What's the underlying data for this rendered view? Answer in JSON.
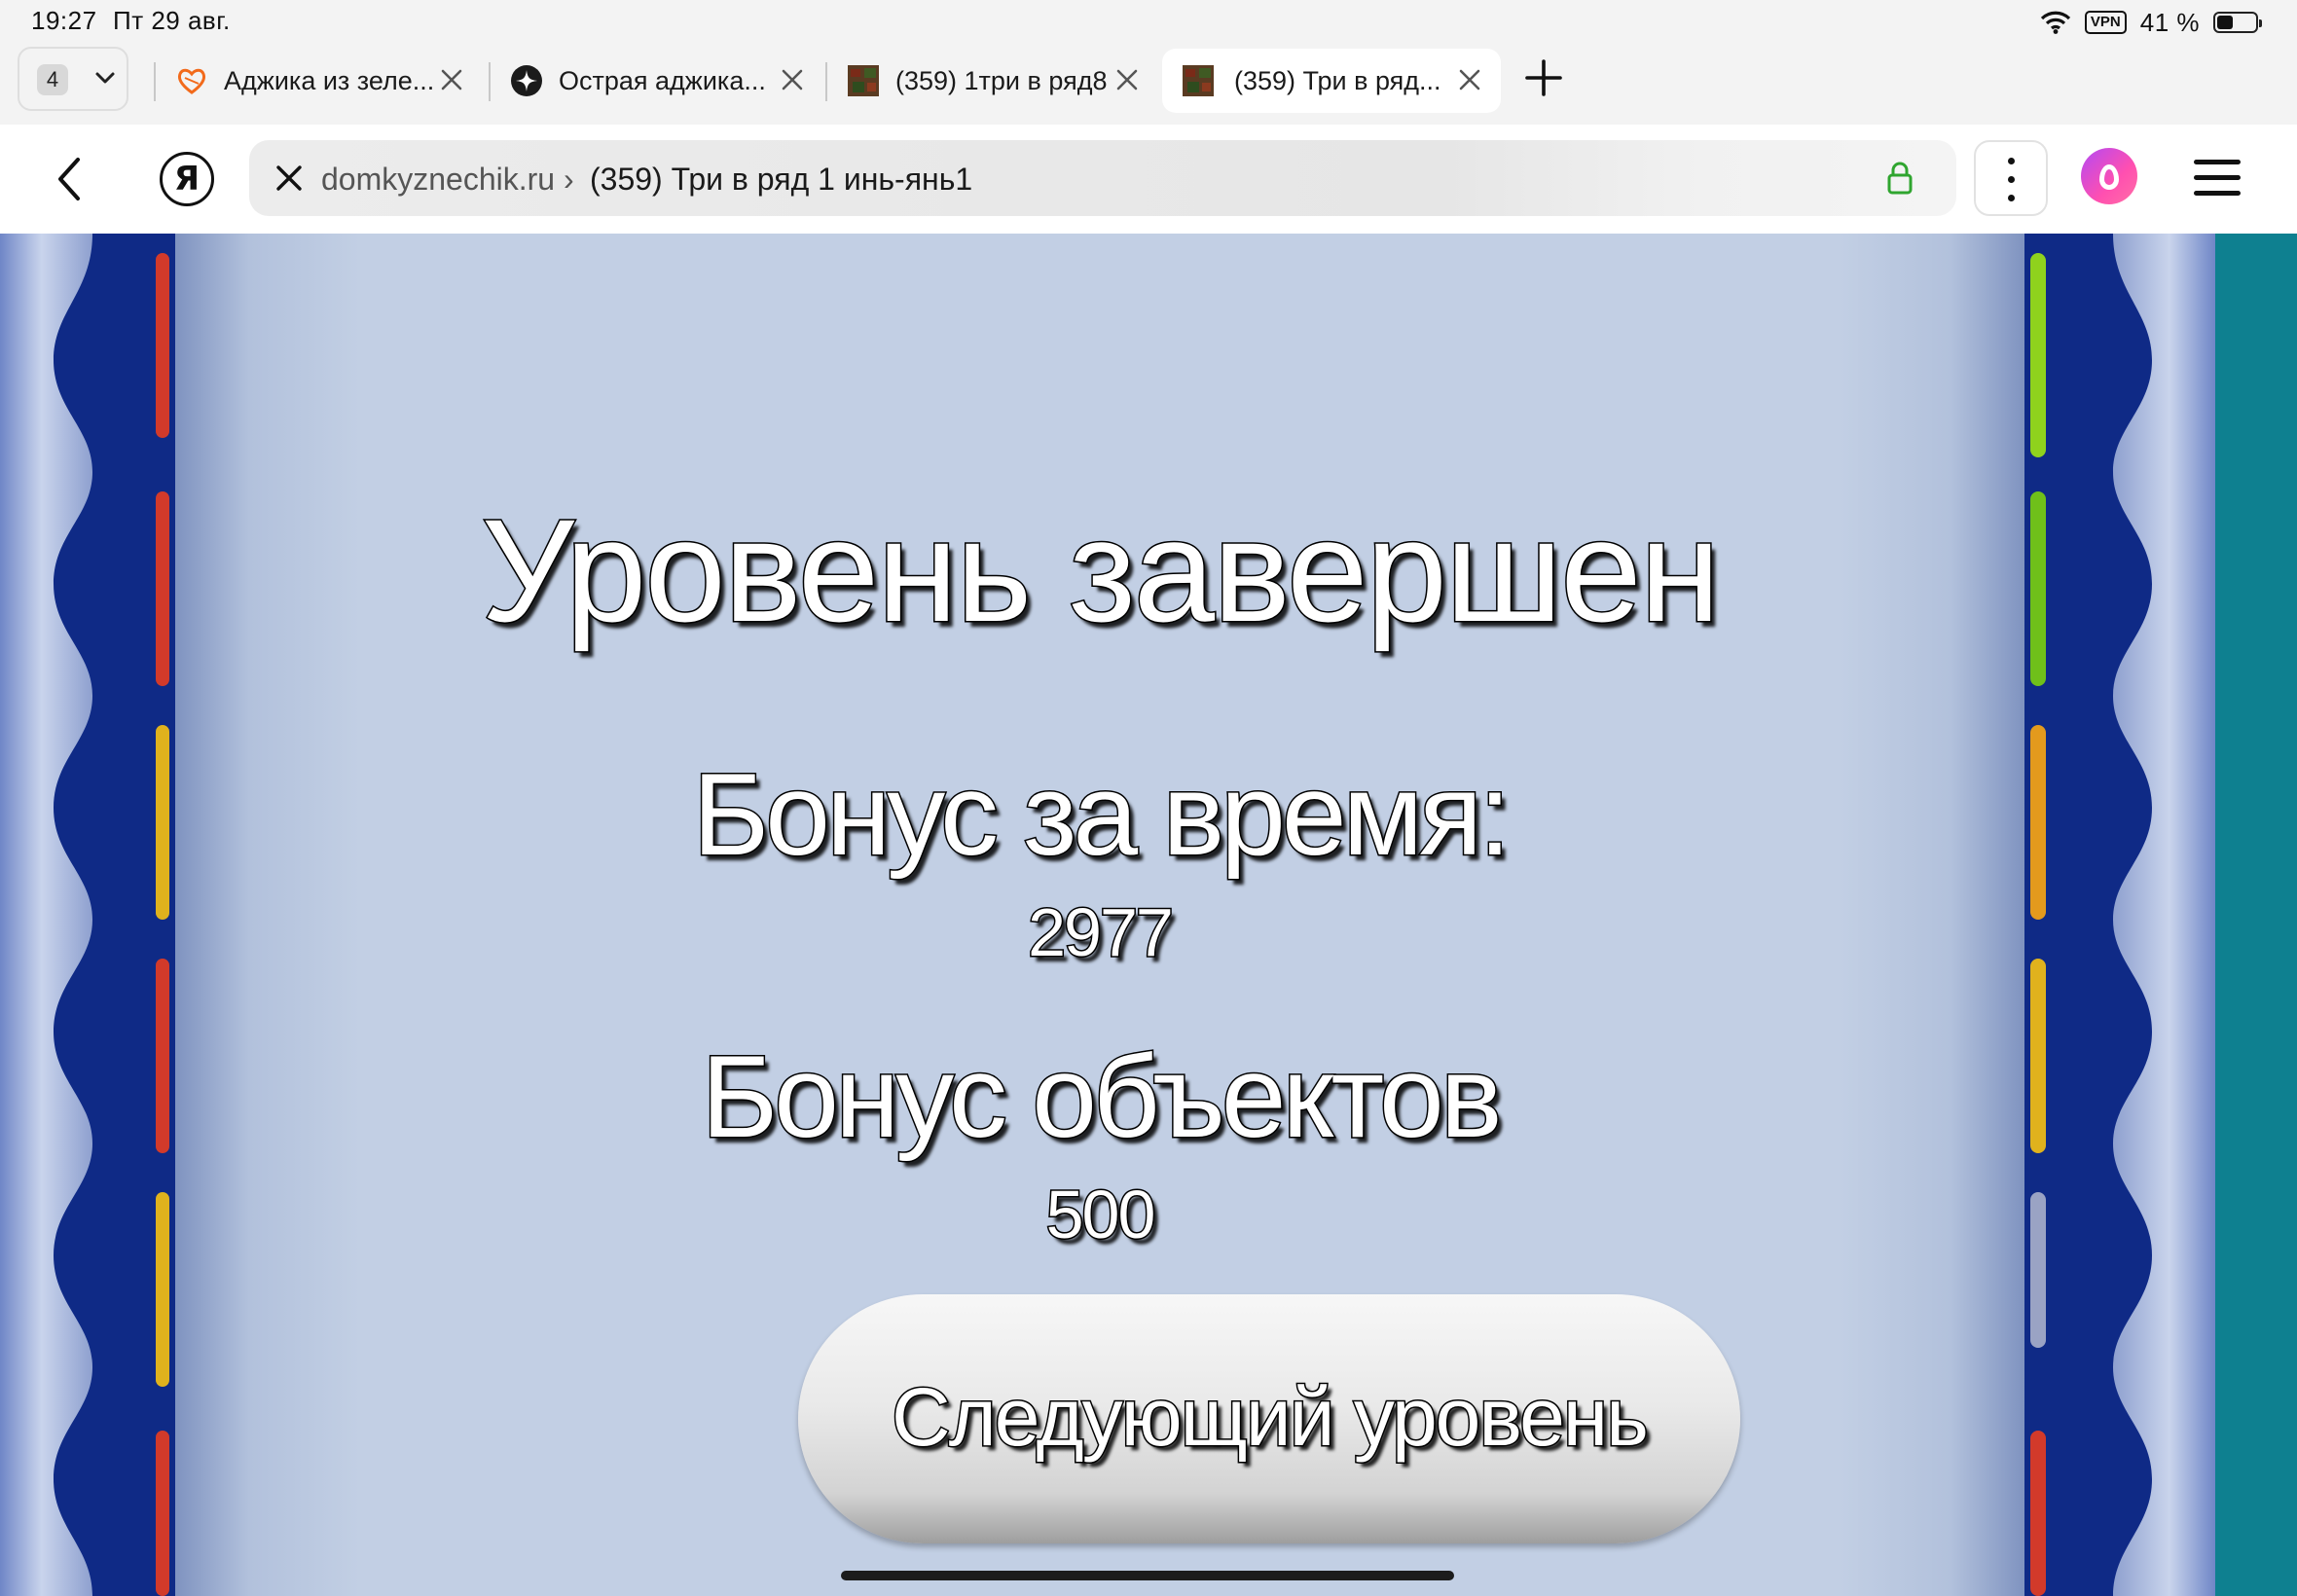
{
  "status_bar": {
    "time": "19:27",
    "date": "Пт 29 авг.",
    "vpn": "VPN",
    "battery": "41 %",
    "battery_level": 0.41
  },
  "tabs": {
    "count": "4",
    "items": [
      {
        "label": "Аджика из зеле...",
        "favicon": "heart-favicon",
        "active": false
      },
      {
        "label": "Острая аджика...",
        "favicon": "sparkle-favicon",
        "active": false
      },
      {
        "label": "(359) 1три в ряд8",
        "favicon": "game-favicon",
        "active": false
      },
      {
        "label": "(359) Три в ряд...",
        "favicon": "game-favicon",
        "active": true
      }
    ]
  },
  "address_bar": {
    "domain": "domkyznechik.ru ›",
    "page_title": "(359) Три в ряд 1 инь-янь1",
    "yandex_letter": "Я"
  },
  "game": {
    "title": "Уровень завершен",
    "time_bonus_label": "Бонус за время:",
    "time_bonus_value": "2977",
    "objects_bonus_label": "Бонус объектов",
    "objects_bonus_value": "500",
    "next_level_button": "Следующий уровень"
  },
  "colors": {
    "frame_blue": "#0f2a86",
    "panel": "#c2cfe4",
    "teal": "#0e8090",
    "lock_green": "#2fa52f"
  }
}
